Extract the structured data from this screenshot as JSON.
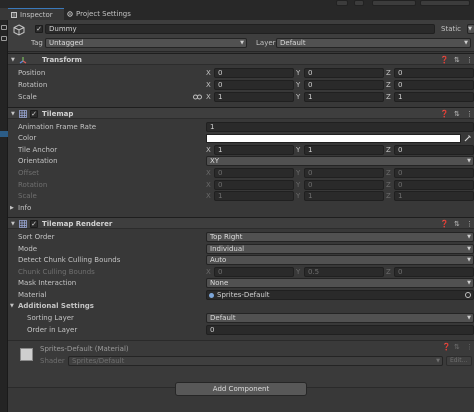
{
  "tabs": [
    {
      "label": "Inspector",
      "icon": "inspector-icon",
      "active": true
    },
    {
      "label": "Project Settings",
      "icon": "gear-icon",
      "active": false
    }
  ],
  "gameobject": {
    "name": "Dummy",
    "active": true,
    "static_label": "Static",
    "tag_label": "Tag",
    "tag_value": "Untagged",
    "layer_label": "Layer",
    "layer_value": "Default"
  },
  "transform": {
    "title": "Transform",
    "position_label": "Position",
    "rotation_label": "Rotation",
    "scale_label": "Scale",
    "position": {
      "x": "0",
      "y": "0",
      "z": "0"
    },
    "rotation": {
      "x": "0",
      "y": "0",
      "z": "0"
    },
    "scale": {
      "x": "1",
      "y": "1",
      "z": "1"
    }
  },
  "axis": {
    "x": "X",
    "y": "Y",
    "z": "Z"
  },
  "tilemap": {
    "title": "Tilemap",
    "enabled": true,
    "animation_frame_rate_label": "Animation Frame Rate",
    "animation_frame_rate": "1",
    "color_label": "Color",
    "color_value": "#ffffff",
    "tile_anchor_label": "Tile Anchor",
    "tile_anchor": {
      "x": "1",
      "y": "1",
      "z": "0"
    },
    "orientation_label": "Orientation",
    "orientation_value": "XY",
    "offset_label": "Offset",
    "offset": {
      "x": "0",
      "y": "0",
      "z": "0"
    },
    "rotation_label": "Rotation",
    "rotation": {
      "x": "0",
      "y": "0",
      "z": "0"
    },
    "scale_label": "Scale",
    "scale": {
      "x": "1",
      "y": "1",
      "z": "1"
    },
    "info_label": "Info"
  },
  "renderer": {
    "title": "Tilemap Renderer",
    "enabled": true,
    "sort_order_label": "Sort Order",
    "sort_order_value": "Top Right",
    "mode_label": "Mode",
    "mode_value": "Individual",
    "detect_chunk_label": "Detect Chunk Culling Bounds",
    "detect_chunk_value": "Auto",
    "chunk_bounds_label": "Chunk Culling Bounds",
    "chunk_bounds": {
      "x": "0",
      "y": "0.5",
      "z": "0"
    },
    "mask_label": "Mask Interaction",
    "mask_value": "None",
    "material_label": "Material",
    "material_value": "Sprites-Default",
    "additional_label": "Additional Settings",
    "sorting_layer_label": "Sorting Layer",
    "sorting_layer_value": "Default",
    "order_label": "Order in Layer",
    "order_value": "0"
  },
  "material_block": {
    "name": "Sprites-Default (Material)",
    "shader_label": "Shader",
    "shader_value": "Sprites/Default",
    "edit_label": "Edit..."
  },
  "add_component_label": "Add Component",
  "colors": {
    "panel_bg": "#383838",
    "header_bg": "#3e3e3e",
    "field_bg": "#2a2a2a",
    "dropdown_bg": "#515151",
    "accent": "#3a79bb"
  }
}
